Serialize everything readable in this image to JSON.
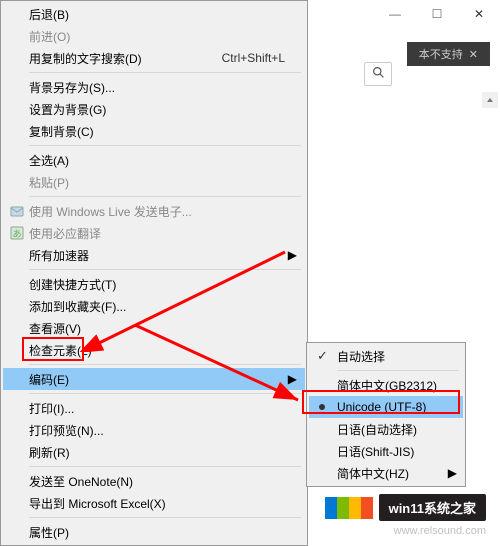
{
  "titlebar": {
    "minimize": "—",
    "maximize": "☐",
    "close": "✕",
    "search_icon": "🔍"
  },
  "background": {
    "tab_text": "本不支持",
    "tab_close": "✕",
    "unsupported": " "
  },
  "menu": {
    "back": "后退(B)",
    "forward": "前进(O)",
    "text_search": "用复制的文字搜索(D)",
    "text_search_shortcut": "Ctrl+Shift+L",
    "save_bg_as": "背景另存为(S)...",
    "set_as_bg": "设置为背景(G)",
    "copy_bg": "复制背景(C)",
    "select_all": "全选(A)",
    "paste": "粘贴(P)",
    "windows_live": "使用 Windows Live 发送电子...",
    "bing_translate": "使用必应翻译",
    "all_accel": "所有加速器",
    "create_shortcut": "创建快捷方式(T)",
    "add_to_fav": "添加到收藏夹(F)...",
    "view_source": "查看源(V)",
    "inspect": "检查元素(L)",
    "encoding": "编码(E)",
    "print": "打印(I)...",
    "print_preview": "打印预览(N)...",
    "refresh": "刷新(R)",
    "send_to_onenote": "发送至 OneNote(N)",
    "export_excel": "导出到 Microsoft Excel(X)",
    "properties": "属性(P)",
    "submenu_arrow": "▶"
  },
  "submenu": {
    "auto_select": "自动选择",
    "gb2312": "简体中文(GB2312)",
    "utf8": "Unicode (UTF-8)",
    "japanese_auto": "日语(自动选择)",
    "shift_jis": "日语(Shift-JIS)",
    "hz": "简体中文(HZ)",
    "arrow": "▶",
    "check": "✓"
  },
  "watermark": {
    "text": "win11系统之家",
    "url": "www.relsound.com"
  }
}
